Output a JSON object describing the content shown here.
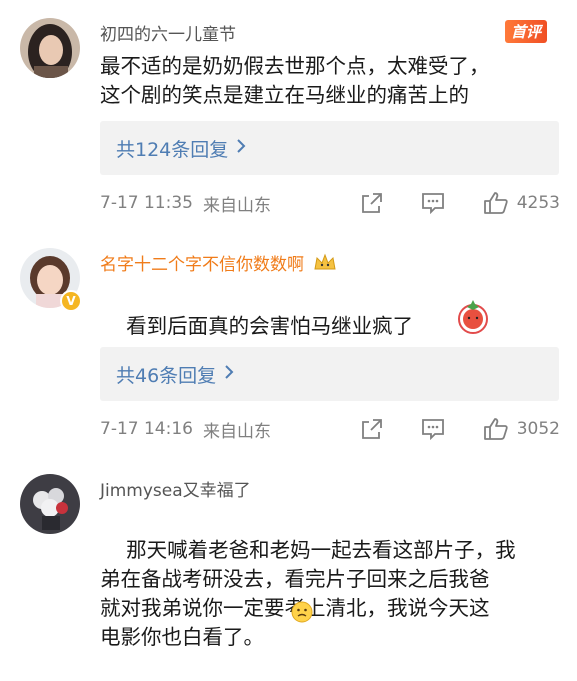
{
  "comments": [
    {
      "username": "初四的六一儿童节",
      "tag": "首评",
      "text": "最不适的是奶奶假去世那个点，太难受了，\n这个剧的笑点是建立在马继业的痛苦上的",
      "replies": "共124条回复",
      "time": "7-17 11:35",
      "location": "来自山东",
      "likes": "4253"
    },
    {
      "username": "名字十二个字不信你数数啊",
      "text": "看到后面真的会害怕马继业疯了",
      "replies": "共46条回复",
      "time": "7-17 14:16",
      "location": "来自山东",
      "likes": "3052"
    },
    {
      "username": "Jimmysea又幸福了",
      "text": "那天喊着老爸和老妈一起去看这部片子，我\n弟在备战考研没去，看完片子回来之后我爸\n就对我弟说你一定要考上清北，我说今天这\n电影你也白看了。"
    }
  ],
  "icons": {
    "share": "share-icon",
    "comment": "comment-icon",
    "like": "thumbs-up-icon",
    "chevron": "chevron-right-icon",
    "crown": "crown-icon",
    "verified": "verified-v-icon",
    "emoji": "emoji-icon",
    "sticker": "tomato-sticker-icon"
  },
  "colors": {
    "link": "#4f7db3",
    "vip_name": "#f07c1a",
    "meta": "#808080",
    "reply_bg": "#f2f2f2"
  }
}
